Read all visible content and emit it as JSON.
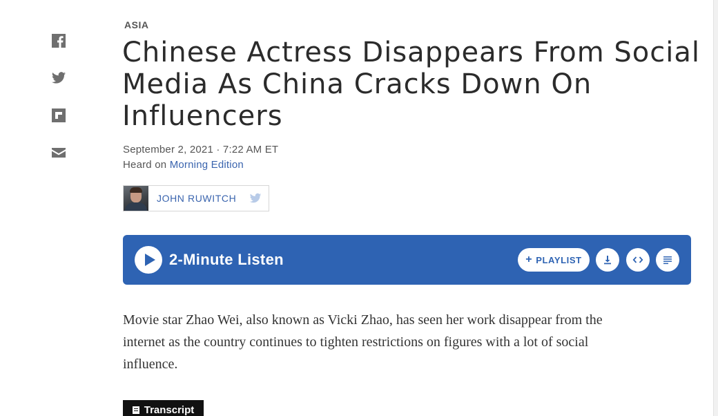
{
  "section": "ASIA",
  "headline": "Chinese Actress Disappears From Social Media As China Cracks Down On Influencers",
  "dateline": "September 2, 2021 · 7:22 AM ET",
  "heard_on": {
    "prefix": "Heard on",
    "program": "Morning Edition"
  },
  "byline": {
    "author": "JOHN RUWITCH"
  },
  "share": {
    "icons": [
      "facebook-icon",
      "twitter-icon",
      "flipboard-icon",
      "email-icon"
    ]
  },
  "player": {
    "listen_label": "2-Minute Listen",
    "playlist_label": "PLAYLIST",
    "color": "#2e63b3"
  },
  "body": {
    "paragraph": "Movie star Zhao Wei, also known as Vicki Zhao, has seen her work disappear from the internet as the country continues to tighten restrictions on figures with a lot of social influence."
  },
  "transcript_label": "Transcript"
}
